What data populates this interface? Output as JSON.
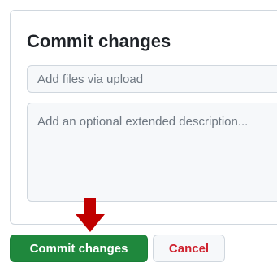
{
  "commit_form": {
    "title": "Commit changes",
    "summary": {
      "value": "",
      "placeholder": "Add files via upload"
    },
    "description": {
      "value": "",
      "placeholder": "Add an optional extended description..."
    },
    "commit_button_label": "Commit changes",
    "cancel_button_label": "Cancel"
  },
  "annotation": {
    "icon": "down-arrow-icon",
    "color": "#c00000"
  },
  "colors": {
    "commit_button": "#1f883d",
    "cancel_text": "#cf222e",
    "border": "#d0d7de"
  }
}
